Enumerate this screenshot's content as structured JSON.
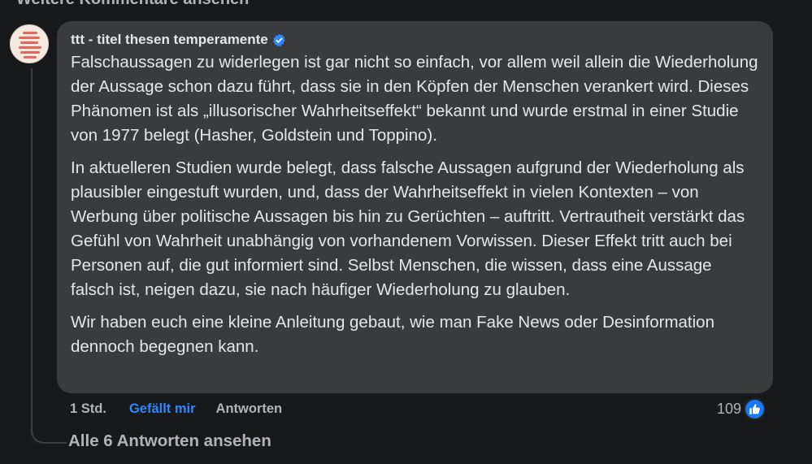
{
  "header": {
    "more_comments_label": "Weitere Kommentare ansehen"
  },
  "comment": {
    "author": "ttt - titel thesen temperamente",
    "verified_icon": "verified-badge-icon",
    "paragraphs": [
      "Falschaussagen zu widerlegen ist gar nicht so einfach, vor allem weil allein die Wiederholung der Aussage schon dazu führt, dass sie in den Köpfen der Menschen verankert wird. Dieses Phänomen ist als „illusorischer Wahrheitseffekt“ bekannt und wurde erstmal in einer Studie von 1977 belegt (Hasher, Goldstein und Toppino).",
      "In aktuelleren Studien wurde belegt, dass falsche Aussagen aufgrund der Wiederholung als plausibler eingestuft wurden, und, dass der Wahrheitseffekt in vielen Kontexten – von Werbung über politische Aussagen bis hin zu Gerüchten – auftritt. Vertrautheit verstärkt das Gefühl von Wahrheit unabhängig von vorhandenem Vorwissen. Dieser Effekt tritt auch bei Personen auf, die gut informiert sind. Selbst Menschen, die wissen, dass eine Aussage falsch ist, neigen dazu, sie nach häufiger Wiederholung zu glauben.",
      "Wir haben euch eine kleine Anleitung gebaut, wie man Fake News oder Desinformation dennoch begegnen kann."
    ],
    "time": "1 Std.",
    "like_label": "Gefällt mir",
    "reply_label": "Antworten",
    "reaction_count": "109",
    "reaction_icon": "thumbs-up-icon",
    "view_replies_label": "Alle 6 Antworten ansehen"
  },
  "colors": {
    "background": "#18191a",
    "bubble": "#3a3b3c",
    "text": "#e4e6eb",
    "secondary_text": "#b0b3b8",
    "accent_blue": "#2d88ff",
    "badge_blue": "#1877f2",
    "avatar_stripes": "#e2685f"
  }
}
